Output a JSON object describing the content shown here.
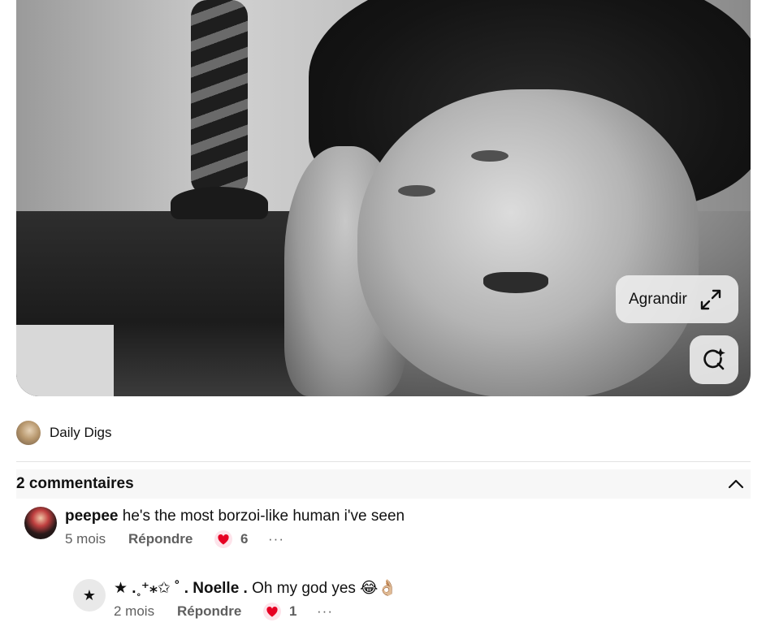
{
  "pin": {
    "enlarge_label": "Agrandir",
    "expand_icon": "expand-arrows-icon",
    "lens_icon": "visual-search-icon"
  },
  "creator": {
    "name": "Daily Digs"
  },
  "comments_section": {
    "title": "2 commentaires",
    "toggle_icon": "chevron-up-icon",
    "comments": [
      {
        "author": "peepee",
        "text": "he's the most borzoi-like human i've seen",
        "time": "5 mois",
        "reply_label": "Répondre",
        "reaction_count": "6"
      },
      {
        "author": "★ .˳⁺⁎✩ ˚ . Noelle .",
        "avatar_glyph": "★",
        "text": "Oh my god yes 😂👌🏼",
        "time": "2 mois",
        "reply_label": "Répondre",
        "reaction_count": "1"
      }
    ]
  },
  "colors": {
    "button_bg": "#ebebeb",
    "text_primary": "#111111",
    "text_secondary": "#5f5f5f",
    "divider": "#e2e2e2",
    "header_bg": "#f7f7f7",
    "heart": "#e60023"
  }
}
